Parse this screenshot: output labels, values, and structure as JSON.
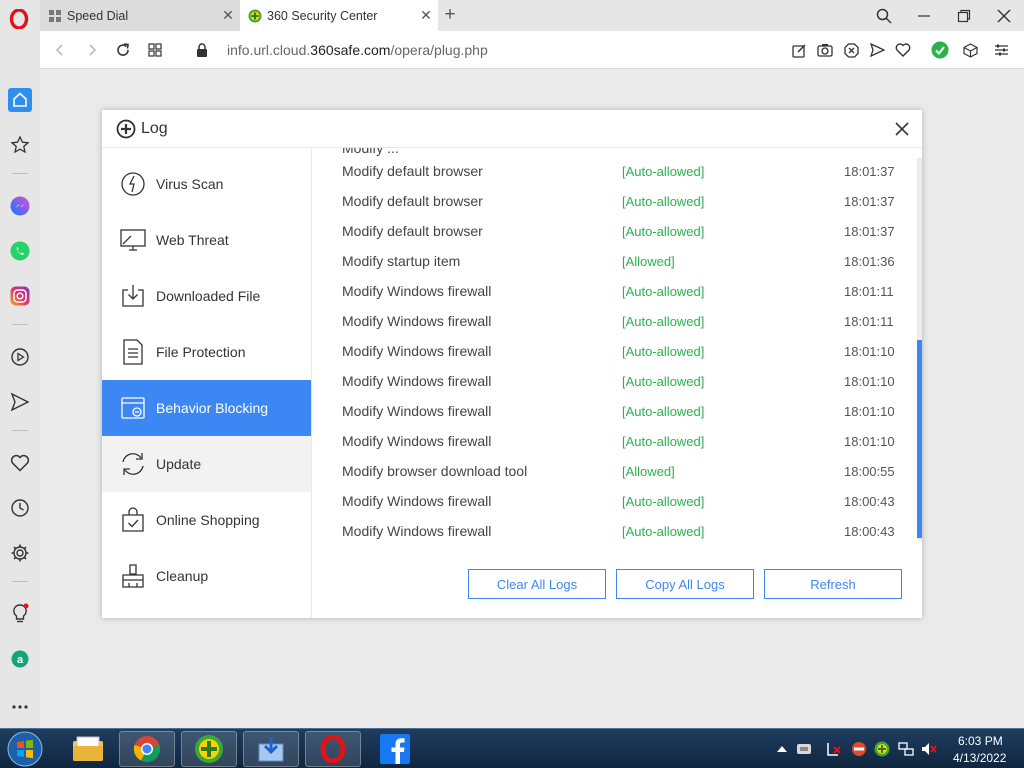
{
  "browser": {
    "tabs": [
      {
        "title": "Speed Dial",
        "active": false
      },
      {
        "title": "360 Security Center",
        "active": true
      }
    ],
    "url": {
      "prefix": "info.url.cloud.",
      "domain": "360safe.com",
      "path": "/opera/plug.php"
    }
  },
  "dialog": {
    "title": "Log",
    "nav": [
      {
        "label": "Virus Scan",
        "icon": "virus-scan-icon",
        "state": "normal"
      },
      {
        "label": "Web Threat",
        "icon": "web-threat-icon",
        "state": "normal"
      },
      {
        "label": "Downloaded File",
        "icon": "downloaded-file-icon",
        "state": "normal"
      },
      {
        "label": "File Protection",
        "icon": "file-protection-icon",
        "state": "normal"
      },
      {
        "label": "Behavior Blocking",
        "icon": "behavior-blocking-icon",
        "state": "active"
      },
      {
        "label": "Update",
        "icon": "update-icon",
        "state": "hover"
      },
      {
        "label": "Online Shopping",
        "icon": "online-shopping-icon",
        "state": "normal"
      },
      {
        "label": "Cleanup",
        "icon": "cleanup-icon",
        "state": "normal"
      }
    ],
    "logs": [
      {
        "action": "Modify default browser",
        "result": "[Auto-allowed]",
        "time": "18:01:37"
      },
      {
        "action": "Modify default browser",
        "result": "[Auto-allowed]",
        "time": "18:01:37"
      },
      {
        "action": "Modify default browser",
        "result": "[Auto-allowed]",
        "time": "18:01:37"
      },
      {
        "action": "Modify startup item",
        "result": "[Allowed]",
        "time": "18:01:36"
      },
      {
        "action": "Modify Windows firewall",
        "result": "[Auto-allowed]",
        "time": "18:01:11"
      },
      {
        "action": "Modify Windows firewall",
        "result": "[Auto-allowed]",
        "time": "18:01:11"
      },
      {
        "action": "Modify Windows firewall",
        "result": "[Auto-allowed]",
        "time": "18:01:10"
      },
      {
        "action": "Modify Windows firewall",
        "result": "[Auto-allowed]",
        "time": "18:01:10"
      },
      {
        "action": "Modify Windows firewall",
        "result": "[Auto-allowed]",
        "time": "18:01:10"
      },
      {
        "action": "Modify Windows firewall",
        "result": "[Auto-allowed]",
        "time": "18:01:10"
      },
      {
        "action": "Modify browser download tool",
        "result": "[Allowed]",
        "time": "18:00:55"
      },
      {
        "action": "Modify Windows firewall",
        "result": "[Auto-allowed]",
        "time": "18:00:43"
      },
      {
        "action": "Modify Windows firewall",
        "result": "[Auto-allowed]",
        "time": "18:00:43"
      }
    ],
    "buttons": {
      "clear": "Clear All Logs",
      "copy": "Copy All Logs",
      "refresh": "Refresh"
    }
  },
  "taskbar": {
    "apps": [
      "explorer",
      "chrome",
      "360-security",
      "downloads",
      "opera",
      "facebook"
    ],
    "clock": {
      "time": "6:03 PM",
      "date": "4/13/2022"
    }
  },
  "colors": {
    "accent": "#3d87f5",
    "allowed_green": "#2ab24f",
    "opera_red": "#e0131b"
  }
}
